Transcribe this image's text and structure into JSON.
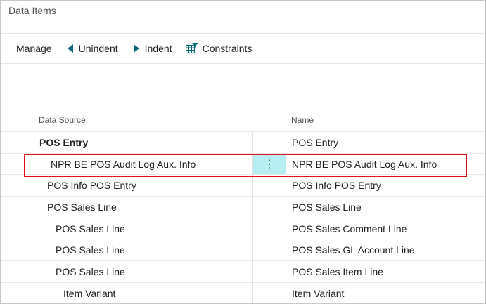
{
  "window": {
    "title": "Data Items"
  },
  "toolbar": {
    "manage_label": "Manage",
    "unindent_label": "Unindent",
    "indent_label": "Indent",
    "constraints_label": "Constraints"
  },
  "columns": {
    "data_source": "Data Source",
    "name": "Name"
  },
  "rows": [
    {
      "data_source": "POS Entry",
      "name": "POS Entry",
      "indent": 0,
      "bold": true
    },
    {
      "data_source": "NPR BE POS Audit Log Aux. Info",
      "name": "NPR BE POS Audit Log Aux. Info",
      "indent": 1,
      "selected": true
    },
    {
      "data_source": "POS Info POS Entry",
      "name": "POS Info POS Entry",
      "indent": 1
    },
    {
      "data_source": "POS Sales Line",
      "name": "POS Sales Line",
      "indent": 1
    },
    {
      "data_source": "POS Sales Line",
      "name": "POS Sales Comment Line",
      "indent": 2
    },
    {
      "data_source": "POS Sales Line",
      "name": "POS Sales GL Account Line",
      "indent": 2
    },
    {
      "data_source": "POS Sales Line",
      "name": "POS Sales Item Line",
      "indent": 2
    },
    {
      "data_source": "Item Variant",
      "name": "Item Variant",
      "indent": 3
    }
  ],
  "row_menu_glyph": "⋮",
  "colors": {
    "accent": "#0b6a7a",
    "selection": "#b6eef1",
    "highlight_border": "#e0141e"
  }
}
